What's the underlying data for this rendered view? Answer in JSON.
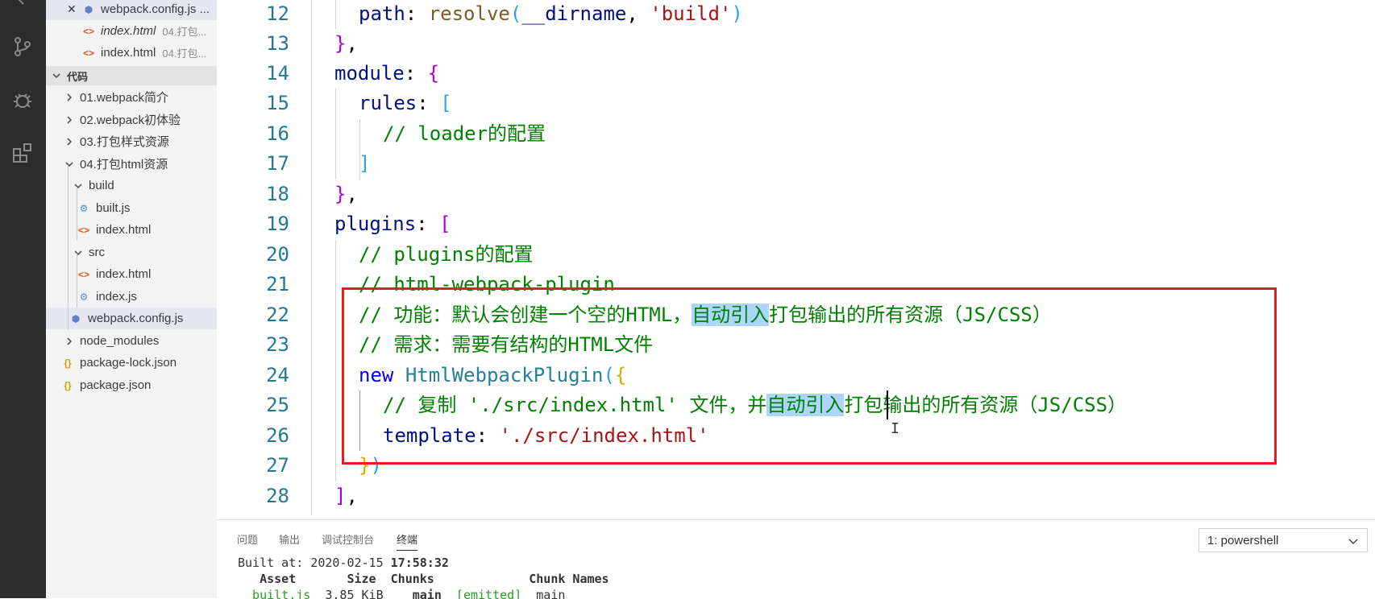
{
  "sidebar": {
    "open_editors": [
      {
        "label": "webpack.config.js ...",
        "desc": ""
      },
      {
        "label": "index.html",
        "desc": "04.打包..."
      },
      {
        "label": "index.html",
        "desc": "04.打包..."
      }
    ],
    "section_title": "代码",
    "tree": [
      {
        "label": "01.webpack简介"
      },
      {
        "label": "02.webpack初体验"
      },
      {
        "label": "03.打包样式资源"
      },
      {
        "label": "04.打包html资源"
      },
      {
        "label": "build"
      },
      {
        "label": "built.js"
      },
      {
        "label": "index.html"
      },
      {
        "label": "src"
      },
      {
        "label": "index.html"
      },
      {
        "label": "index.js"
      },
      {
        "label": "webpack.config.js"
      },
      {
        "label": "node_modules"
      },
      {
        "label": "package-lock.json"
      },
      {
        "label": "package.json"
      }
    ]
  },
  "editor": {
    "line_numbers": [
      "12",
      "13",
      "14",
      "15",
      "16",
      "17",
      "18",
      "19",
      "20",
      "21",
      "22",
      "23",
      "24",
      "25",
      "26",
      "27",
      "28"
    ],
    "lines": {
      "l12_prop": "path",
      "l12_func": "resolve",
      "l12_arg1": "__dirname",
      "l12_arg2": "'build'",
      "l14_prop": "module",
      "l15_prop": "rules",
      "l16_comment": "// loader的配置",
      "l19_prop": "plugins",
      "l20_comment": "// plugins的配置",
      "l21_comment": "// html-webpack-plugin",
      "l22_comment_a": "// 功能：默认会创建一个空的HTML，",
      "l22_comment_hl": "自动引入",
      "l22_comment_b": "打包输出的所有资源（JS/CSS）",
      "l23_comment": "// 需求：需要有结构的HTML文件",
      "l24_kw": "new",
      "l24_cls": "HtmlWebpackPlugin",
      "l25_comment_a": "// 复制 './src/index.html' 文件，并",
      "l25_comment_hl": "自动引入",
      "l25_comment_b": "打包输出的所有资源（JS/CSS）",
      "l26_prop": "template",
      "l26_str": "'./src/index.html'"
    }
  },
  "panel": {
    "tabs": [
      "问题",
      "输出",
      "调试控制台",
      "终端"
    ],
    "active_tab": "终端",
    "terminal_select": "1: powershell",
    "terminal_lines": {
      "built_at_label": "Built at: 2020-02-15 ",
      "built_at_time": "17:58:32",
      "header": "   Asset       Size  Chunks             Chunk Names",
      "row_asset": "  built.js",
      "row_size": "  3.85 KiB",
      "row_chunks": "    main",
      "row_emitted": "  [emitted]",
      "row_names": "  main"
    }
  }
}
